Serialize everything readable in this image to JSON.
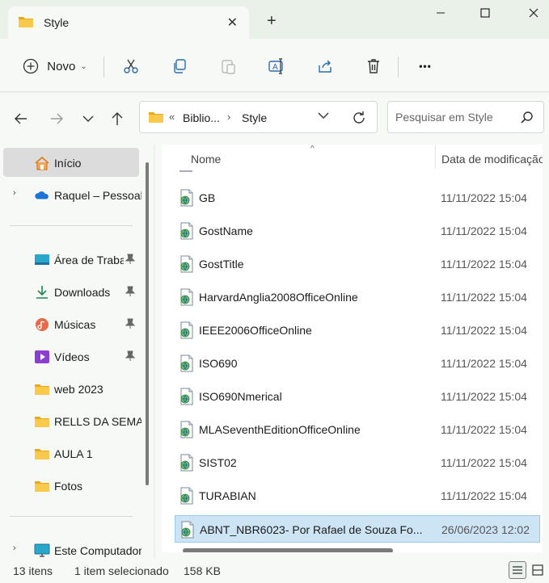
{
  "window": {
    "tab_title": "Style",
    "tab_close": "✕",
    "new_tab": "+"
  },
  "toolbar": {
    "new_label": "Novo",
    "new_chevron": "⌄",
    "more": "•••",
    "icons": [
      "cut-icon",
      "copy-icon",
      "paste-icon",
      "rename-icon",
      "share-icon",
      "delete-icon"
    ]
  },
  "address": {
    "overflow": "«",
    "crumb1": "Biblio...",
    "separator": "›",
    "crumb2": "Style"
  },
  "search": {
    "placeholder": "Pesquisar em Style"
  },
  "sidebar": {
    "items": [
      {
        "label": "Início",
        "icon": "home-icon"
      },
      {
        "label": "Raquel – Pessoal",
        "icon": "onedrive-icon"
      },
      {
        "label": "Área de Trabalho",
        "icon": "desktop-icon",
        "pinned": true
      },
      {
        "label": "Downloads",
        "icon": "download-icon",
        "pinned": true
      },
      {
        "label": "Músicas",
        "icon": "music-icon",
        "pinned": true
      },
      {
        "label": "Vídeos",
        "icon": "video-icon",
        "pinned": true
      },
      {
        "label": "web 2023",
        "icon": "folder-icon"
      },
      {
        "label": "RELLS DA SEMANA",
        "icon": "folder-icon"
      },
      {
        "label": "AULA 1",
        "icon": "folder-icon"
      },
      {
        "label": "Fotos",
        "icon": "folder-icon"
      },
      {
        "label": "Este Computador",
        "icon": "computer-icon"
      }
    ]
  },
  "columns": {
    "name": "Nome",
    "date": "Data de modificação"
  },
  "files": [
    {
      "name": "GB",
      "date": "11/11/2022 15:04"
    },
    {
      "name": "GostName",
      "date": "11/11/2022 15:04"
    },
    {
      "name": "GostTitle",
      "date": "11/11/2022 15:04"
    },
    {
      "name": "HarvardAnglia2008OfficeOnline",
      "date": "11/11/2022 15:04"
    },
    {
      "name": "IEEE2006OfficeOnline",
      "date": "11/11/2022 15:04"
    },
    {
      "name": "ISO690",
      "date": "11/11/2022 15:04"
    },
    {
      "name": "ISO690Nmerical",
      "date": "11/11/2022 15:04"
    },
    {
      "name": "MLASeventhEditionOfficeOnline",
      "date": "11/11/2022 15:04"
    },
    {
      "name": "SIST02",
      "date": "11/11/2022 15:04"
    },
    {
      "name": "TURABIAN",
      "date": "11/11/2022 15:04"
    },
    {
      "name": "ABNT_NBR6023- Por Rafael de Souza Fo...",
      "date": "26/06/2023 12:02",
      "selected": true
    }
  ],
  "status": {
    "count": "13 itens",
    "selection": "1 item selecionado",
    "size": "158 KB"
  },
  "colors": {
    "accent": "#0067c0",
    "selection_bg": "#cde4f5",
    "folder": "#f4c542"
  }
}
